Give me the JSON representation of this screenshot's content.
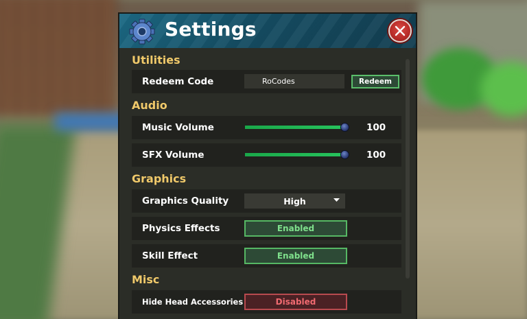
{
  "window": {
    "title": "Settings",
    "icons": {
      "title_icon": "gear-icon",
      "close_icon": "close-icon"
    }
  },
  "sections": {
    "utilities": "Utilities",
    "audio": "Audio",
    "graphics": "Graphics",
    "misc": "Misc"
  },
  "redeem": {
    "label": "Redeem Code",
    "input_value": "RoCodes",
    "button_label": "Redeem"
  },
  "music": {
    "label": "Music Volume",
    "value": "100",
    "level": 1.0
  },
  "sfx": {
    "label": "SFX Volume",
    "value": "100",
    "level": 1.0
  },
  "graphics_quality": {
    "label": "Graphics Quality",
    "selected": "High"
  },
  "physics": {
    "label": "Physics Effects",
    "state": "Enabled"
  },
  "skill": {
    "label": "Skill Effect",
    "state": "Enabled"
  },
  "hide_head": {
    "label": "Hide Head Accessories",
    "state": "Disabled"
  },
  "colors": {
    "section_title": "#f0c96a",
    "enabled": "#56b864",
    "disabled": "#b84a4f",
    "slider_fill": "#27c35d",
    "close": "#b82b27"
  }
}
